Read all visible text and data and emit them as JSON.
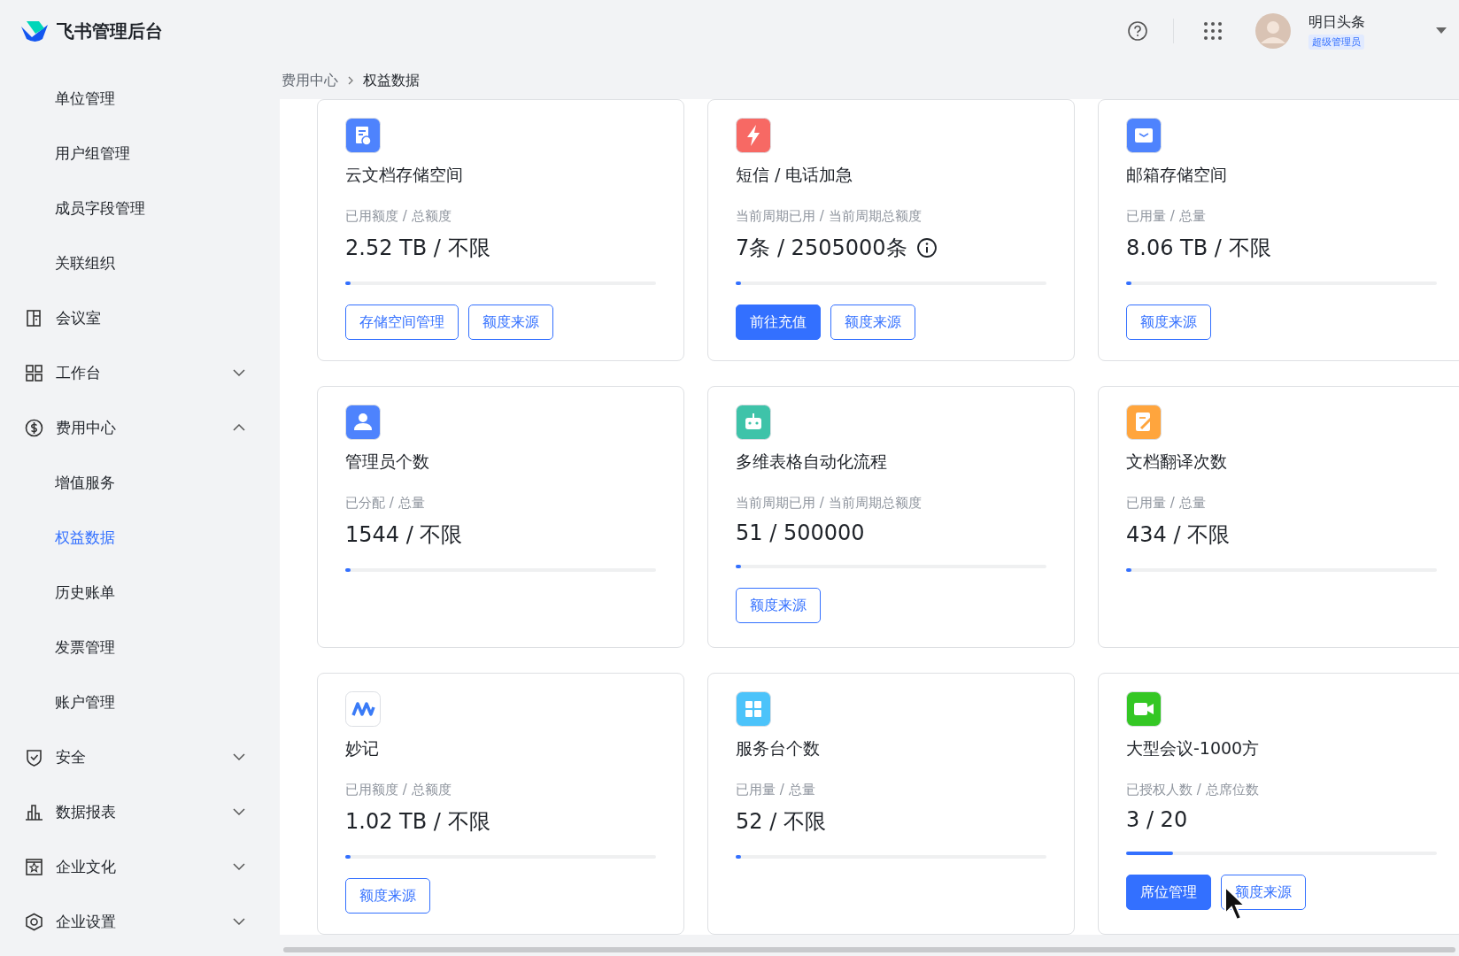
{
  "header": {
    "title": "飞书管理后台",
    "user": {
      "name": "明日头条",
      "role": "超级管理员"
    }
  },
  "sidebar": {
    "items": [
      {
        "label": "单位管理",
        "kind": "child",
        "selected": false
      },
      {
        "label": "用户组管理",
        "kind": "child",
        "selected": false
      },
      {
        "label": "成员字段管理",
        "kind": "child",
        "selected": false
      },
      {
        "label": "关联组织",
        "kind": "child",
        "selected": false
      },
      {
        "label": "会议室",
        "kind": "group",
        "selected": false
      },
      {
        "label": "工作台",
        "kind": "group",
        "expanded": false,
        "selected": false
      },
      {
        "label": "费用中心",
        "kind": "group",
        "expanded": true,
        "selected": false
      },
      {
        "label": "增值服务",
        "kind": "child",
        "selected": false
      },
      {
        "label": "权益数据",
        "kind": "child",
        "selected": true
      },
      {
        "label": "历史账单",
        "kind": "child",
        "selected": false
      },
      {
        "label": "发票管理",
        "kind": "child",
        "selected": false
      },
      {
        "label": "账户管理",
        "kind": "child",
        "selected": false
      },
      {
        "label": "安全",
        "kind": "group",
        "expanded": false,
        "selected": false
      },
      {
        "label": "数据报表",
        "kind": "group",
        "expanded": false,
        "selected": false
      },
      {
        "label": "企业文化",
        "kind": "group",
        "expanded": false,
        "selected": false
      },
      {
        "label": "企业设置",
        "kind": "group",
        "expanded": false,
        "selected": false
      }
    ]
  },
  "breadcrumb": [
    "费用中心",
    "权益数据"
  ],
  "cards": [
    {
      "color": "#4e83fd",
      "title": "云文档存储空间",
      "label": "已用额度 / 总额度",
      "value": "2.52 TB / 不限",
      "info": false,
      "level": 0.01,
      "buttons": [
        {
          "label": "存储空间管理",
          "kind": "outline"
        },
        {
          "label": "额度来源",
          "kind": "outline"
        }
      ]
    },
    {
      "color": "#f76964",
      "title": "短信 / 电话加急",
      "label": "当前周期已用 / 当前周期总额度",
      "value": "7条 / 2505000条",
      "info": true,
      "level": 0.01,
      "buttons": [
        {
          "label": "前往充值",
          "kind": "primary"
        },
        {
          "label": "额度来源",
          "kind": "outline"
        }
      ]
    },
    {
      "color": "#4e83fd",
      "title": "邮箱存储空间",
      "label": "已用量 / 总量",
      "value": "8.06 TB / 不限",
      "info": false,
      "level": 0.01,
      "buttons": [
        {
          "label": "额度来源",
          "kind": "outline"
        }
      ]
    },
    {
      "color": "#4e83fd",
      "title": "管理员个数",
      "label": "已分配 / 总量",
      "value": "1544 / 不限",
      "info": false,
      "level": 0.01
    },
    {
      "color": "#3ec3a9",
      "title": "多维表格自动化流程",
      "label": "当前周期已用 / 当前周期总额度",
      "value": "51 / 500000",
      "info": false,
      "level": 0.01,
      "buttons": [
        {
          "label": "额度来源",
          "kind": "outline"
        }
      ]
    },
    {
      "color": "#ffa53d",
      "title": "文档翻译次数",
      "label": "已用量 / 总量",
      "value": "434 / 不限",
      "info": false,
      "level": 0.01
    },
    {
      "color": "#ffffff",
      "title": "妙记",
      "label": "已用额度 / 总额度",
      "value": "1.02 TB / 不限",
      "info": false,
      "level": 0.01,
      "buttons": [
        {
          "label": "额度来源",
          "kind": "outline"
        }
      ]
    },
    {
      "color": "#4cc3fa",
      "title": "服务台个数",
      "label": "已用量 / 总量",
      "value": "52 / 不限",
      "info": false,
      "level": 0.01
    },
    {
      "color": "#34c724",
      "title": "大型会议-1000方",
      "label": "已授权人数 / 总席位数",
      "value": "3 / 20",
      "info": false,
      "level": 0.15,
      "buttons": [
        {
          "label": "席位管理",
          "kind": "primary"
        },
        {
          "label": "额度来源",
          "kind": "outline"
        }
      ]
    }
  ]
}
